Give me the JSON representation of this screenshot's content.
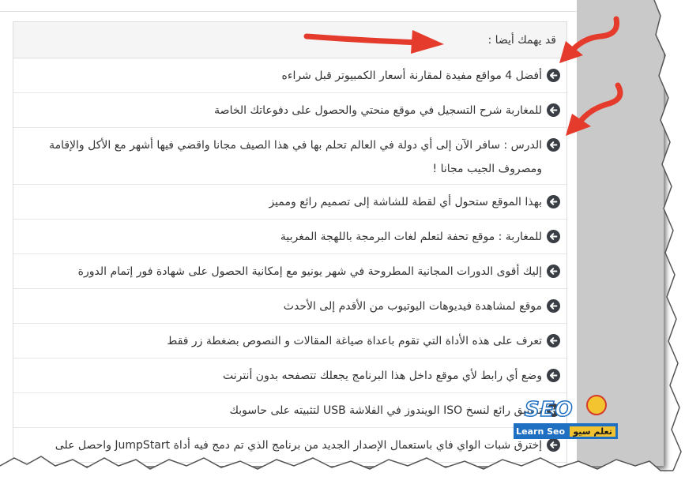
{
  "panel": {
    "heading": "قد يهمك أيضا :",
    "items": [
      "أفضل 4 مواقع مفيدة لمقارنة أسعار الكمبيوتر قبل شراءه",
      "للمغاربة شرح التسجيل في موقع منحتي والحصول على دفوعاتك الخاصة",
      "الدرس : سافر الآن إلى أي دولة في العالم تحلم بها في هذا الصيف مجانا واقضي فيها أشهر مع الأكل والإقامة ومصروف الجيب مجانا !",
      "بهذا الموقع ستحول أي لقطة للشاشة إلى تصميم رائع ومميز",
      "للمغاربة : موقع تحفة لتعلم لغات البرمجة باللهجة المغربية",
      "إليك أقوى الدورات المجانية المطروحة في شهر يونيو مع إمكانية الحصول على شهادة فور إتمام الدورة",
      "موقع لمشاهدة فيديوهات اليوتيوب من الأقدم إلى الأحدث",
      "تعرف على هذه الأداة التي تقوم باعداة صياغة المقالات و النصوص بضغطة زر فقط",
      "وضع أي رابط لأي موقع داخل هذا البرنامج يجعلك تتصفحه بدون أنترنت",
      "تطبيق رائع لنسخ ISO الويندوز في الفلاشة USB لتثبيته على حاسوبك",
      "إخترق شبات الواي فاي باستعمال الإصدار الجديد من برنامج الذي تم دمج فيه أداة JumpStart واحصل على"
    ]
  },
  "logo": {
    "mark": "SEO",
    "latin": "Learn Seo",
    "arabic": "تعلم سيو"
  },
  "colors": {
    "annotation_arrow": "#e53b2c",
    "bullet": "#3a3f46",
    "logo_blue": "#1f6fc2"
  }
}
